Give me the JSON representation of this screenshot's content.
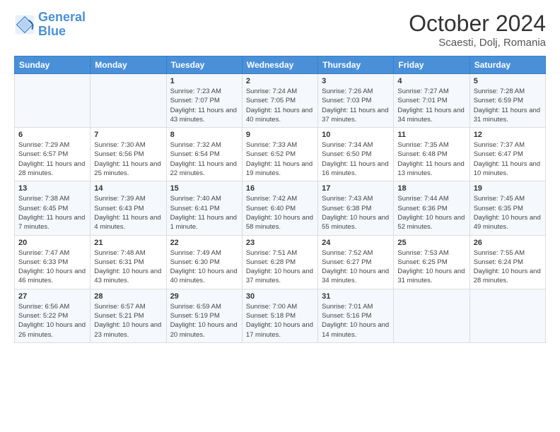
{
  "header": {
    "logo_line1": "General",
    "logo_line2": "Blue",
    "month": "October 2024",
    "location": "Scaesti, Dolj, Romania"
  },
  "weekdays": [
    "Sunday",
    "Monday",
    "Tuesday",
    "Wednesday",
    "Thursday",
    "Friday",
    "Saturday"
  ],
  "weeks": [
    [
      {
        "day": "",
        "text": ""
      },
      {
        "day": "",
        "text": ""
      },
      {
        "day": "1",
        "text": "Sunrise: 7:23 AM\nSunset: 7:07 PM\nDaylight: 11 hours and 43 minutes."
      },
      {
        "day": "2",
        "text": "Sunrise: 7:24 AM\nSunset: 7:05 PM\nDaylight: 11 hours and 40 minutes."
      },
      {
        "day": "3",
        "text": "Sunrise: 7:26 AM\nSunset: 7:03 PM\nDaylight: 11 hours and 37 minutes."
      },
      {
        "day": "4",
        "text": "Sunrise: 7:27 AM\nSunset: 7:01 PM\nDaylight: 11 hours and 34 minutes."
      },
      {
        "day": "5",
        "text": "Sunrise: 7:28 AM\nSunset: 6:59 PM\nDaylight: 11 hours and 31 minutes."
      }
    ],
    [
      {
        "day": "6",
        "text": "Sunrise: 7:29 AM\nSunset: 6:57 PM\nDaylight: 11 hours and 28 minutes."
      },
      {
        "day": "7",
        "text": "Sunrise: 7:30 AM\nSunset: 6:56 PM\nDaylight: 11 hours and 25 minutes."
      },
      {
        "day": "8",
        "text": "Sunrise: 7:32 AM\nSunset: 6:54 PM\nDaylight: 11 hours and 22 minutes."
      },
      {
        "day": "9",
        "text": "Sunrise: 7:33 AM\nSunset: 6:52 PM\nDaylight: 11 hours and 19 minutes."
      },
      {
        "day": "10",
        "text": "Sunrise: 7:34 AM\nSunset: 6:50 PM\nDaylight: 11 hours and 16 minutes."
      },
      {
        "day": "11",
        "text": "Sunrise: 7:35 AM\nSunset: 6:48 PM\nDaylight: 11 hours and 13 minutes."
      },
      {
        "day": "12",
        "text": "Sunrise: 7:37 AM\nSunset: 6:47 PM\nDaylight: 11 hours and 10 minutes."
      }
    ],
    [
      {
        "day": "13",
        "text": "Sunrise: 7:38 AM\nSunset: 6:45 PM\nDaylight: 11 hours and 7 minutes."
      },
      {
        "day": "14",
        "text": "Sunrise: 7:39 AM\nSunset: 6:43 PM\nDaylight: 11 hours and 4 minutes."
      },
      {
        "day": "15",
        "text": "Sunrise: 7:40 AM\nSunset: 6:41 PM\nDaylight: 11 hours and 1 minute."
      },
      {
        "day": "16",
        "text": "Sunrise: 7:42 AM\nSunset: 6:40 PM\nDaylight: 10 hours and 58 minutes."
      },
      {
        "day": "17",
        "text": "Sunrise: 7:43 AM\nSunset: 6:38 PM\nDaylight: 10 hours and 55 minutes."
      },
      {
        "day": "18",
        "text": "Sunrise: 7:44 AM\nSunset: 6:36 PM\nDaylight: 10 hours and 52 minutes."
      },
      {
        "day": "19",
        "text": "Sunrise: 7:45 AM\nSunset: 6:35 PM\nDaylight: 10 hours and 49 minutes."
      }
    ],
    [
      {
        "day": "20",
        "text": "Sunrise: 7:47 AM\nSunset: 6:33 PM\nDaylight: 10 hours and 46 minutes."
      },
      {
        "day": "21",
        "text": "Sunrise: 7:48 AM\nSunset: 6:31 PM\nDaylight: 10 hours and 43 minutes."
      },
      {
        "day": "22",
        "text": "Sunrise: 7:49 AM\nSunset: 6:30 PM\nDaylight: 10 hours and 40 minutes."
      },
      {
        "day": "23",
        "text": "Sunrise: 7:51 AM\nSunset: 6:28 PM\nDaylight: 10 hours and 37 minutes."
      },
      {
        "day": "24",
        "text": "Sunrise: 7:52 AM\nSunset: 6:27 PM\nDaylight: 10 hours and 34 minutes."
      },
      {
        "day": "25",
        "text": "Sunrise: 7:53 AM\nSunset: 6:25 PM\nDaylight: 10 hours and 31 minutes."
      },
      {
        "day": "26",
        "text": "Sunrise: 7:55 AM\nSunset: 6:24 PM\nDaylight: 10 hours and 28 minutes."
      }
    ],
    [
      {
        "day": "27",
        "text": "Sunrise: 6:56 AM\nSunset: 5:22 PM\nDaylight: 10 hours and 26 minutes."
      },
      {
        "day": "28",
        "text": "Sunrise: 6:57 AM\nSunset: 5:21 PM\nDaylight: 10 hours and 23 minutes."
      },
      {
        "day": "29",
        "text": "Sunrise: 6:59 AM\nSunset: 5:19 PM\nDaylight: 10 hours and 20 minutes."
      },
      {
        "day": "30",
        "text": "Sunrise: 7:00 AM\nSunset: 5:18 PM\nDaylight: 10 hours and 17 minutes."
      },
      {
        "day": "31",
        "text": "Sunrise: 7:01 AM\nSunset: 5:16 PM\nDaylight: 10 hours and 14 minutes."
      },
      {
        "day": "",
        "text": ""
      },
      {
        "day": "",
        "text": ""
      }
    ]
  ]
}
